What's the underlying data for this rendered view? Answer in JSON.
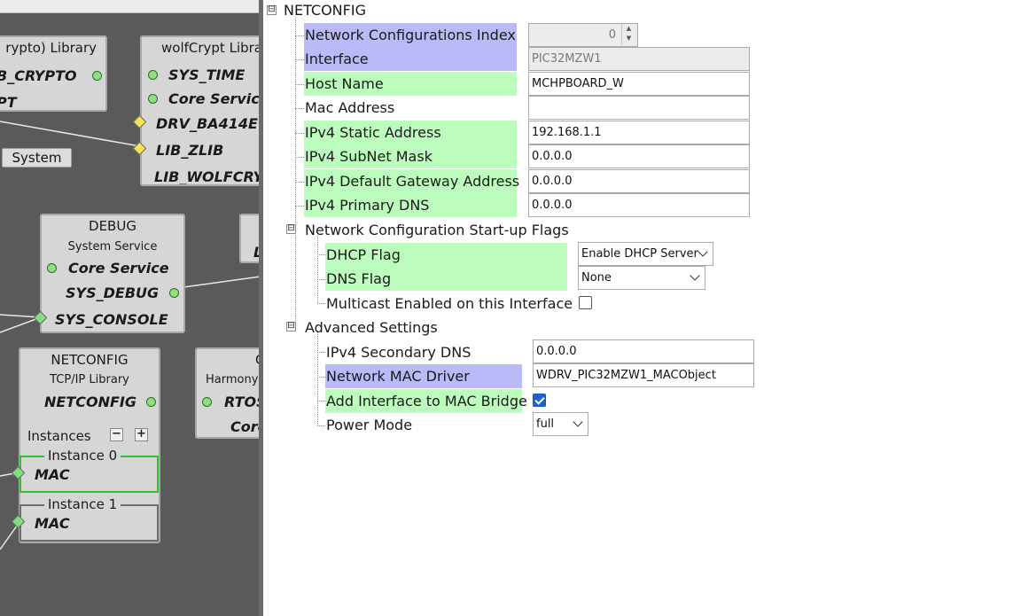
{
  "canvas": {
    "system_button": "System",
    "crypto_lib": {
      "title": "rypto) Library",
      "ports": [
        "B_CRYPTO",
        "PT"
      ]
    },
    "wolfcrypt": {
      "title": "wolfCrypt Libra",
      "ports": [
        "SYS_TIME",
        "Core Service",
        "DRV_BA414E",
        "LIB_ZLIB",
        "LIB_WOLFCRY"
      ]
    },
    "debug": {
      "title": "DEBUG",
      "subtitle": "System Service",
      "ports": [
        "Core Service",
        "SYS_DEBUG",
        "SYS_CONSOLE"
      ]
    },
    "debug_neighbor": {
      "port": "L"
    },
    "netconfig": {
      "title": "NETCONFIG",
      "subtitle": "TCP/IP Library",
      "port": "NETCONFIG",
      "instances_label": "Instances",
      "minus": "−",
      "plus": "+",
      "instances": [
        {
          "label": "Instance 0",
          "port": "MAC"
        },
        {
          "label": "Instance 1",
          "port": "MAC"
        }
      ]
    },
    "harmony": {
      "title": "C",
      "subtitle": "Harmony",
      "ports": [
        "RTOS",
        "Core"
      ]
    }
  },
  "panel": {
    "root": {
      "expander": "⊟",
      "label": "NETCONFIG"
    },
    "rows": [
      {
        "label": "Network Configurations Index",
        "value": "0"
      },
      {
        "label": "Interface",
        "value": "PIC32MZW1"
      },
      {
        "label": "Host Name",
        "value": "MCHPBOARD_W"
      },
      {
        "label": "Mac Address",
        "value": ""
      },
      {
        "label": "IPv4 Static Address",
        "value": "192.168.1.1"
      },
      {
        "label": "IPv4 SubNet Mask",
        "value": "0.0.0.0"
      },
      {
        "label": "IPv4 Default Gateway Address",
        "value": "0.0.0.0"
      },
      {
        "label": "IPv4 Primary DNS",
        "value": "0.0.0.0"
      }
    ],
    "startup_flags": {
      "label": "Network Configuration Start-up Flags",
      "dhcp": {
        "label": "DHCP Flag",
        "value": "Enable DHCP Server"
      },
      "dns": {
        "label": "DNS Flag",
        "value": "None"
      },
      "multicast": {
        "label": "Multicast Enabled on this Interface",
        "checked": false
      }
    },
    "advanced": {
      "label": "Advanced Settings",
      "secondary_dns": {
        "label": "IPv4 Secondary DNS",
        "value": "0.0.0.0"
      },
      "mac_driver": {
        "label": "Network MAC Driver",
        "value": "WDRV_PIC32MZW1_MACObject"
      },
      "mac_bridge": {
        "label": "Add Interface to MAC Bridge",
        "checked": true
      },
      "power_mode": {
        "label": "Power Mode",
        "value": "full"
      }
    }
  }
}
